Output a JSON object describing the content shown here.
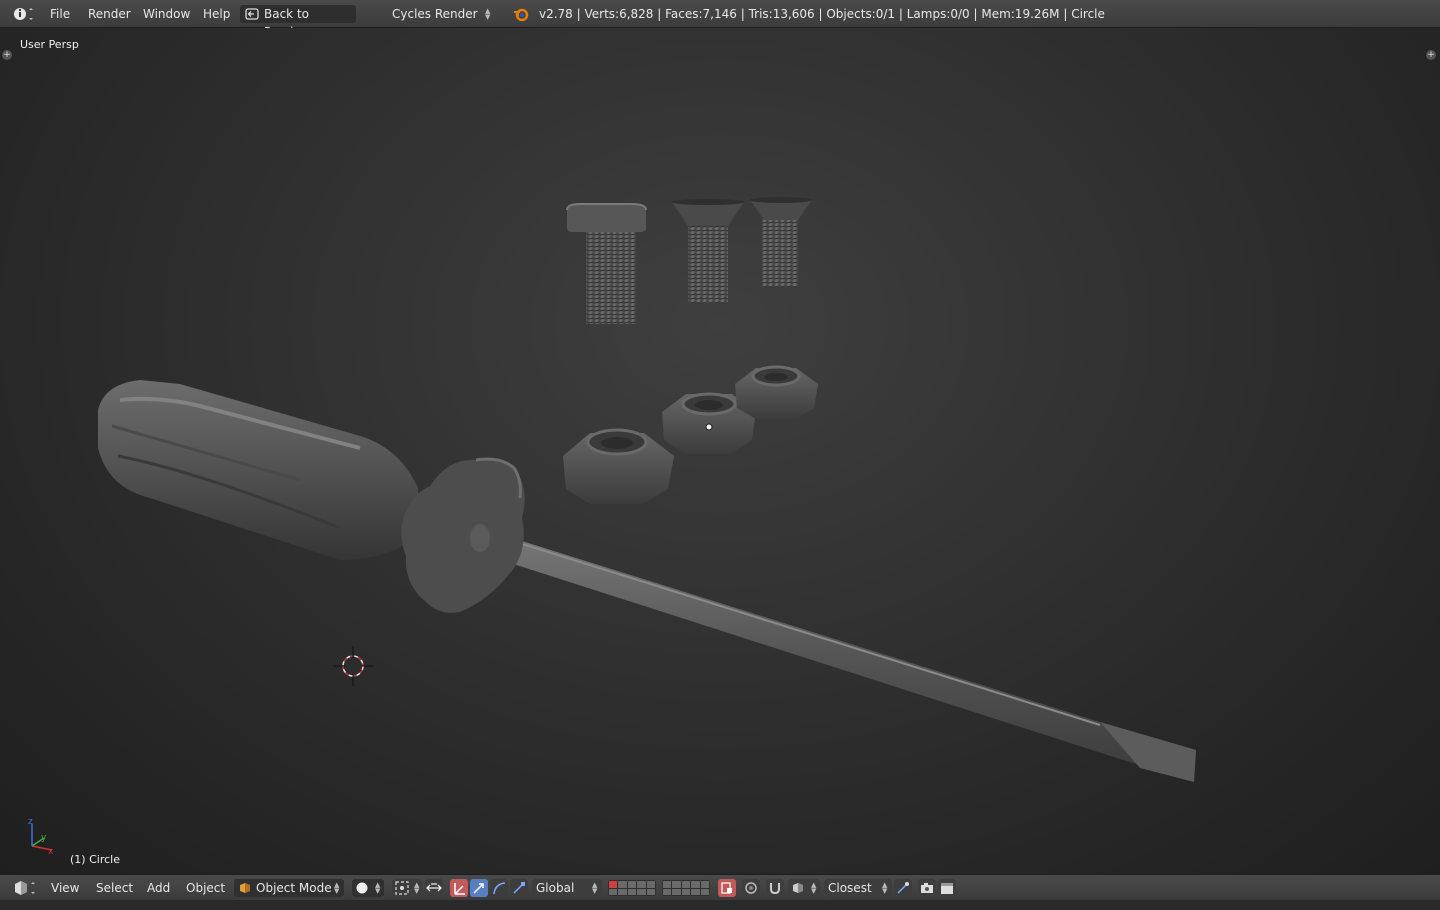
{
  "topbar": {
    "info_icon": "info-icon",
    "menus": [
      "File",
      "Render",
      "Window",
      "Help"
    ],
    "back_button": "Back to Previous",
    "render_engine": "Cycles Render",
    "stats": "v2.78 | Verts:6,828 | Faces:7,146 | Tris:13,606 | Objects:0/1 | Lamps:0/0 | Mem:19.26M | Circle"
  },
  "viewport": {
    "view_label": "User Persp",
    "object_label": "(1) Circle"
  },
  "bottombar": {
    "menus": [
      "View",
      "Select",
      "Add",
      "Object"
    ],
    "mode": "Object Mode",
    "orientation": "Global",
    "snap_target": "Closest"
  },
  "colors": {
    "accent_red": "#c15a5a",
    "accent_blue": "#5680c2",
    "blender_orange": "#e87d0d"
  }
}
